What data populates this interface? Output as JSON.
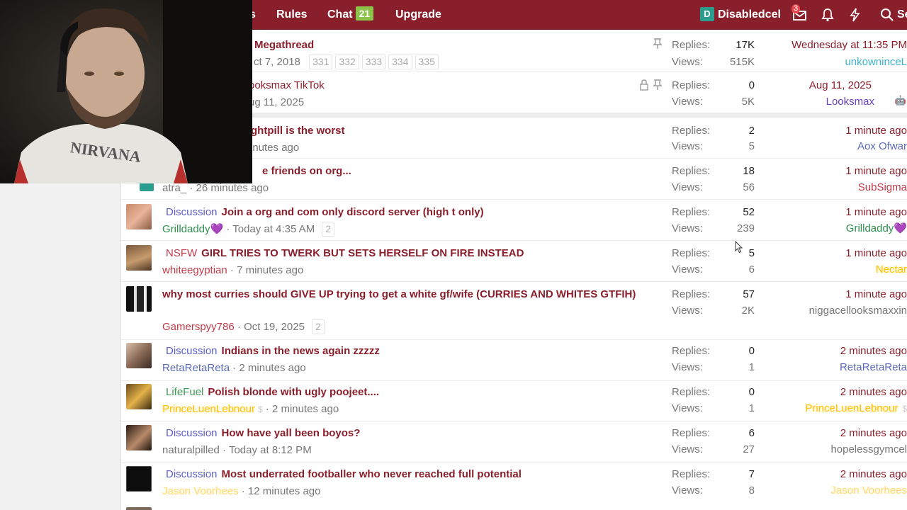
{
  "nav": {
    "partial_item": "s",
    "rules": "Rules",
    "chat": "Chat",
    "chat_count": "21",
    "upgrade": "Upgrade",
    "username": "Disabledcel",
    "user_initial": "D",
    "messages_count": "3",
    "search_label": "Se"
  },
  "colors": {
    "brand": "#8a1f2c",
    "accent_link": "#5a6bb8",
    "chat_badge": "#8bc34a"
  },
  "sticky_threads": [
    {
      "title": "Megathread",
      "date": "ct 7, 2018",
      "pages": [
        "331",
        "332",
        "333",
        "334",
        "335"
      ],
      "replies_label": "Replies:",
      "replies": "17K",
      "views_label": "Views:",
      "views": "515K",
      "last_date": "Wednesday at 11:35 PM",
      "last_user": "unkowninceL",
      "icons": [
        "pin-icon"
      ]
    },
    {
      "title": "ooksmax TikTok",
      "date": "ug 11, 2025",
      "replies_label": "Replies:",
      "replies": "0",
      "views_label": "Views:",
      "views": "5K",
      "last_date": "Aug 11, 2025",
      "last_user": "Looksmax",
      "icons": [
        "lock-icon",
        "pin-icon"
      ]
    }
  ],
  "threads": [
    {
      "prefix": "",
      "title": "ghtpill is the worst",
      "author": "",
      "date": "inutes ago",
      "replies_label": "Replies:",
      "replies": "2",
      "views_label": "Views:",
      "views": "5",
      "last_date": "1 minute ago",
      "last_user": "Aox Ofwar"
    },
    {
      "prefix": "",
      "title": "e friends on org...",
      "author": "atra_",
      "date": "26 minutes ago",
      "replies_label": "Replies:",
      "replies": "18",
      "views_label": "Views:",
      "views": "56",
      "last_date": "1 minute ago",
      "last_user": "SubSigma"
    },
    {
      "prefix": "Discussion",
      "title": "Join a org and com only discord server (high t only)",
      "author": "Grilldaddy",
      "heart": "💜",
      "date": "Today at 4:35 AM",
      "page": "2",
      "replies_label": "Replies:",
      "replies": "52",
      "views_label": "Views:",
      "views": "239",
      "last_date": "1 minute ago",
      "last_user": "Grilldaddy",
      "last_heart": "💜"
    },
    {
      "prefix": "NSFW",
      "title": "GIRL TRIES TO TWERK BUT SETS HERSELF ON FIRE INSTEAD",
      "author": "whiteegyptian",
      "date": "7 minutes ago",
      "replies_label": "Replies:",
      "replies": "5",
      "views_label": "Views:",
      "views": "6",
      "last_date": "1 minute ago",
      "last_user": "Nectar"
    },
    {
      "prefix": "",
      "title": "why most curries should GIVE UP trying to get a white gf/wife (CURRIES AND WHITES GTFIH)",
      "author": "Gamerspyy786",
      "date": "Oct 19, 2025",
      "page": "2",
      "replies_label": "Replies:",
      "replies": "57",
      "views_label": "Views:",
      "views": "2K",
      "last_date": "1 minute ago",
      "last_user": "niggacellooksmaxxin"
    },
    {
      "prefix": "Discussion",
      "title": "Indians in the news again zzzzz",
      "author": "RetaRetaReta",
      "date": "2 minutes ago",
      "replies_label": "Replies:",
      "replies": "0",
      "views_label": "Views:",
      "views": "1",
      "last_date": "2 minutes ago",
      "last_user": "RetaRetaReta"
    },
    {
      "prefix": "LifeFuel",
      "title": "Polish blonde with ugly poojeet....",
      "author": "PrinceLuenLebnour",
      "date": "2 minutes ago",
      "replies_label": "Replies:",
      "replies": "0",
      "views_label": "Views:",
      "views": "1",
      "last_date": "2 minutes ago",
      "last_user": "PrinceLuenLebnour"
    },
    {
      "prefix": "Discussion",
      "title": "How have yall been boyos?",
      "author": "naturalpilled",
      "date": "Today at 8:12 PM",
      "replies_label": "Replies:",
      "replies": "6",
      "views_label": "Views:",
      "views": "27",
      "last_date": "2 minutes ago",
      "last_user": "hopelessgymcel"
    },
    {
      "prefix": "Discussion",
      "title": "Most underrated footballer who never reached full potential",
      "author": "Jason Voorhees",
      "date": "12 minutes ago",
      "replies_label": "Replies:",
      "replies": "7",
      "views_label": "Views:",
      "views": "8",
      "last_date": "2 minutes ago",
      "last_user": "Jason Voorhees"
    }
  ]
}
